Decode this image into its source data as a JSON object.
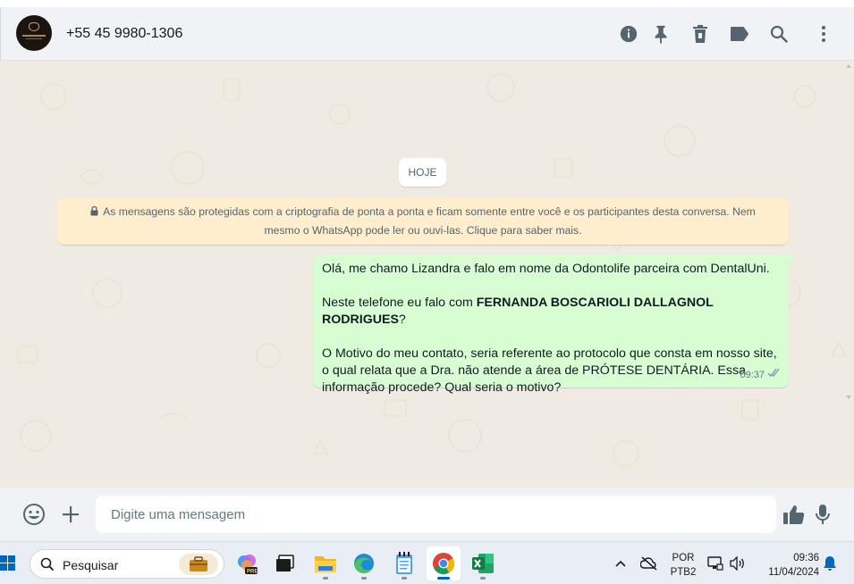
{
  "header": {
    "contact_name": "+55 45 9980-1306",
    "icons": [
      "info-icon",
      "pin-icon",
      "delete-icon",
      "label-icon",
      "search-icon",
      "menu-icon"
    ]
  },
  "chat": {
    "date_label": "HOJE",
    "encryption_notice": "As mensagens são protegidas com a criptografia de ponta a ponta e ficam somente entre você e os participantes desta conversa. Nem mesmo o WhatsApp pode ler ou ouvi-las. Clique para saber mais.",
    "message": {
      "line1": "Olá, me chamo Lizandra e falo em nome da Odontolife parceira com DentalUni.",
      "line2_prefix": "Neste telefone eu falo com ",
      "line2_bold": "FERNANDA BOSCARIOLI DALLAGNOL RODRIGUES",
      "line2_suffix": "?",
      "line3": "O Motivo do meu contato, seria referente ao protocolo que consta em nosso site, o qual relata que a Dra. não atende a área de PRÓTESE DENTÁRIA. Essa informação procede? Qual seria o motivo?",
      "time": "09:37",
      "status": "read"
    }
  },
  "composer": {
    "placeholder": "Digite uma mensagem"
  },
  "taskbar": {
    "search_label": "Pesquisar",
    "language": "POR",
    "layout": "PTB2",
    "time": "09:36",
    "date": "11/04/2024"
  },
  "colors": {
    "outgoing_bubble": "#d9fdd3",
    "notice_bg": "#ffeecd",
    "chat_bg": "#efeae2",
    "header_bg": "#f0f2f5",
    "icon_gray": "#54656f"
  }
}
